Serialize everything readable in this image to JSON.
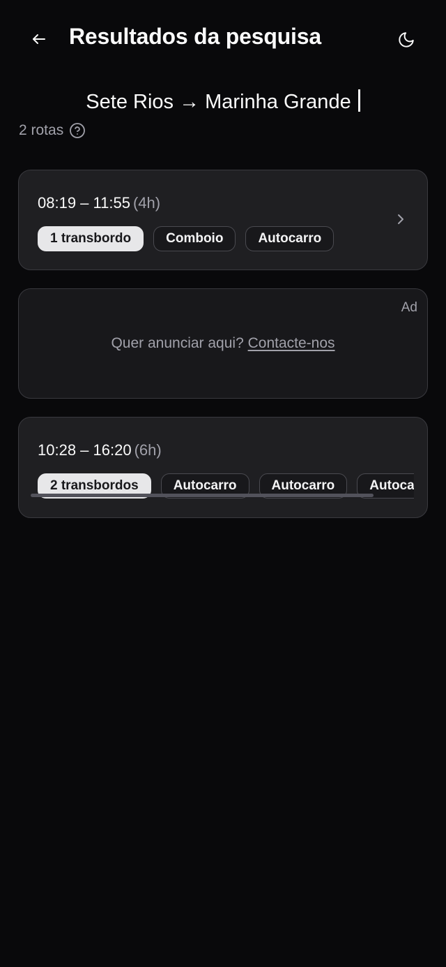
{
  "header": {
    "title": "Resultados da pesquisa",
    "back_icon": "arrow-left-icon",
    "theme_icon": "moon-icon"
  },
  "search": {
    "route": "Sete Rios → Marinha Grande"
  },
  "results": {
    "count_label": "2 rotas",
    "help_icon": "question-circle-icon"
  },
  "routes": [
    {
      "time": "08:19 – 11:55",
      "duration": "(4h)",
      "chips": [
        "1 transbordo",
        "Comboio",
        "Autocarro"
      ]
    },
    {
      "time": "10:28 – 16:20",
      "duration": "(6h)",
      "chips": [
        "2 transbordos",
        "Autocarro",
        "Autocarro",
        "Autocarro"
      ]
    }
  ],
  "ad": {
    "tag": "Ad",
    "text": "Quer anunciar aqui?",
    "link": "Contacte-nos"
  },
  "colors": {
    "background": "#09090b",
    "card": "#1f1f22",
    "chip_highlight": "#e7e7e9",
    "muted_text": "#a1a1aa"
  }
}
